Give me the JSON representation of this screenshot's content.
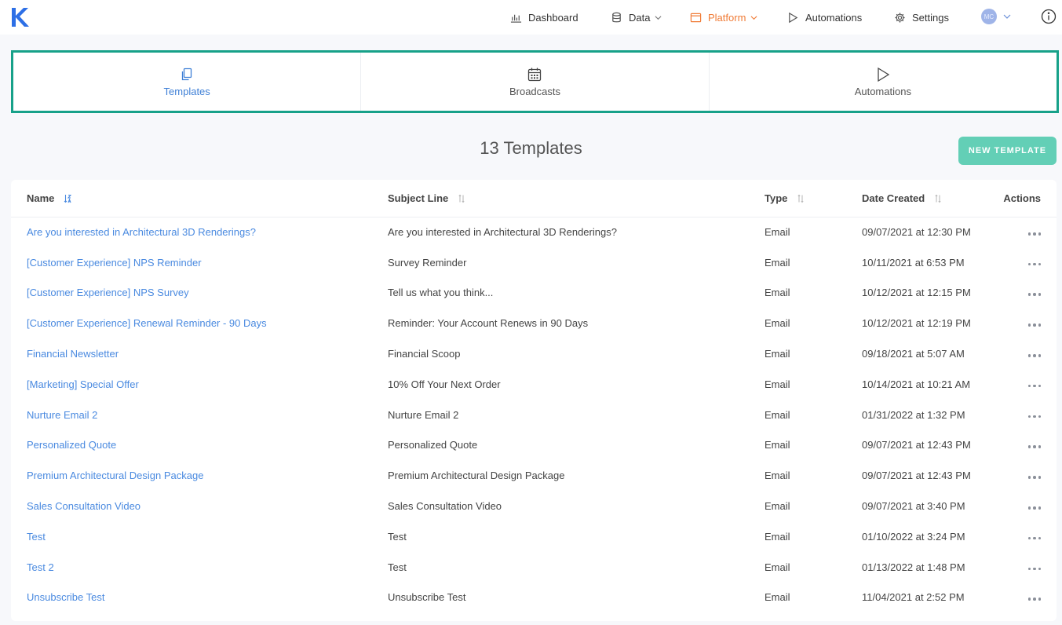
{
  "brand": {
    "logo_letter": "K",
    "accent": "#2d6fe6"
  },
  "topnav": {
    "items": [
      {
        "label": "Dashboard",
        "icon": "bar-chart-icon"
      },
      {
        "label": "Data",
        "icon": "database-icon",
        "dropdown": true
      },
      {
        "label": "Platform",
        "icon": "window-icon",
        "dropdown": true,
        "active": true
      },
      {
        "label": "Automations",
        "icon": "play-icon"
      },
      {
        "label": "Settings",
        "icon": "gear-icon"
      }
    ],
    "avatar_initials": "MC",
    "info_icon": "info-icon"
  },
  "subtabs": [
    {
      "label": "Templates",
      "icon": "copy-icon",
      "active": true
    },
    {
      "label": "Broadcasts",
      "icon": "calendar-icon"
    },
    {
      "label": "Automations",
      "icon": "play-icon"
    }
  ],
  "page": {
    "title": "13 Templates",
    "new_button": "NEW TEMPLATE"
  },
  "table": {
    "headers": {
      "name": "Name",
      "subject": "Subject Line",
      "type": "Type",
      "date": "Date Created",
      "actions": "Actions"
    },
    "rows": [
      {
        "name": "Are you interested in Architectural 3D Renderings?",
        "subject": "Are you interested in Architectural 3D Renderings?",
        "type": "Email",
        "date": "09/07/2021 at 12:30 PM"
      },
      {
        "name": "[Customer Experience] NPS Reminder",
        "subject": "Survey Reminder",
        "type": "Email",
        "date": "10/11/2021 at 6:53 PM"
      },
      {
        "name": "[Customer Experience] NPS Survey",
        "subject": "Tell us what you think...",
        "type": "Email",
        "date": "10/12/2021 at 12:15 PM"
      },
      {
        "name": "[Customer Experience] Renewal Reminder - 90 Days",
        "subject": "Reminder: Your Account Renews in 90 Days",
        "type": "Email",
        "date": "10/12/2021 at 12:19 PM"
      },
      {
        "name": "Financial Newsletter",
        "subject": "Financial Scoop",
        "type": "Email",
        "date": "09/18/2021 at 5:07 AM"
      },
      {
        "name": "[Marketing] Special Offer",
        "subject": "10% Off Your Next Order",
        "type": "Email",
        "date": "10/14/2021 at 10:21 AM"
      },
      {
        "name": "Nurture Email 2",
        "subject": "Nurture Email 2",
        "type": "Email",
        "date": "01/31/2022 at 1:32 PM"
      },
      {
        "name": "Personalized Quote",
        "subject": "Personalized Quote",
        "type": "Email",
        "date": "09/07/2021 at 12:43 PM"
      },
      {
        "name": "Premium Architectural Design Package",
        "subject": "Premium Architectural Design Package",
        "type": "Email",
        "date": "09/07/2021 at 12:43 PM"
      },
      {
        "name": "Sales Consultation Video",
        "subject": "Sales Consultation Video",
        "type": "Email",
        "date": "09/07/2021 at 3:40 PM"
      },
      {
        "name": "Test",
        "subject": "Test",
        "type": "Email",
        "date": "01/10/2022 at 3:24 PM"
      },
      {
        "name": "Test 2",
        "subject": "Test",
        "type": "Email",
        "date": "01/13/2022 at 1:48 PM"
      },
      {
        "name": "Unsubscribe Test",
        "subject": "Unsubscribe Test",
        "type": "Email",
        "date": "11/04/2021 at 2:52 PM"
      }
    ]
  },
  "colors": {
    "link": "#4a8ae0",
    "active_nav": "#f07b36",
    "primary_button": "#63cfb6",
    "highlight_border": "#17a189"
  }
}
